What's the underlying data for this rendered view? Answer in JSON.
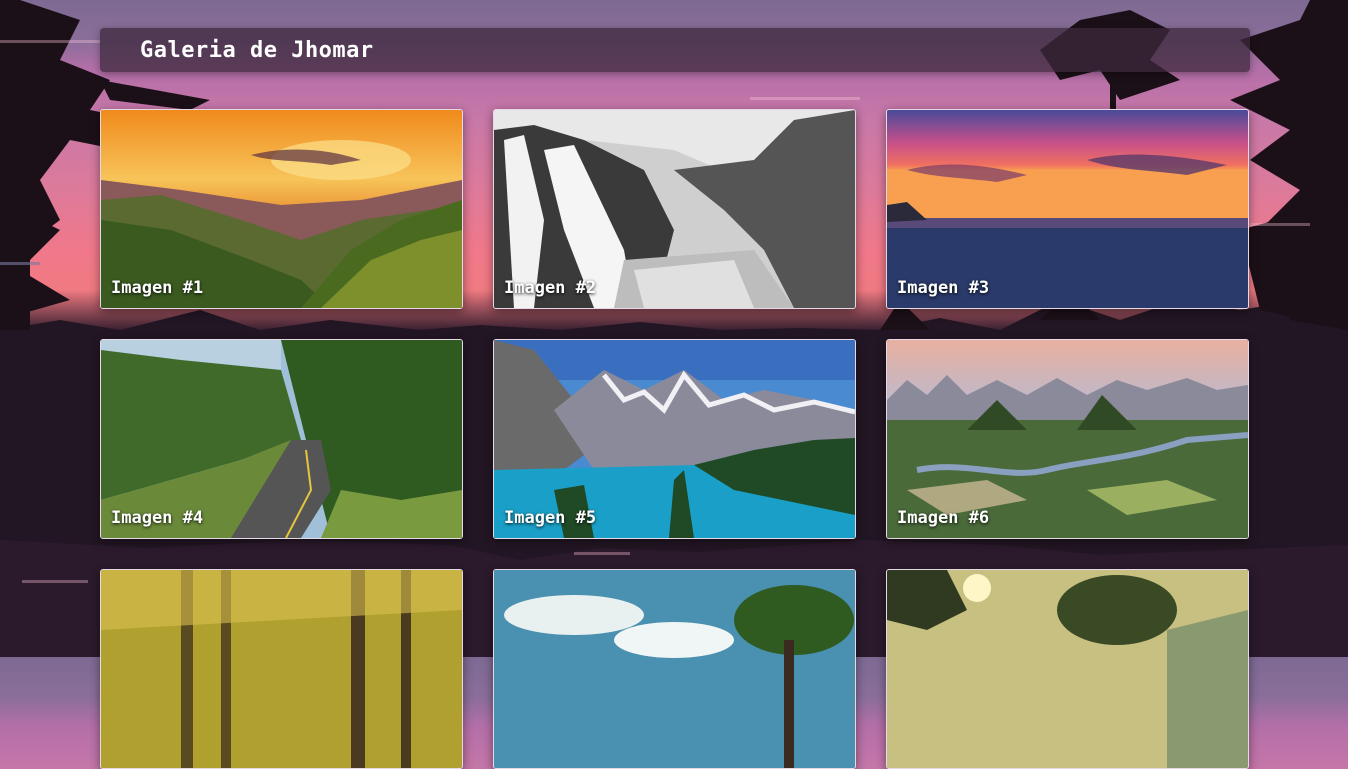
{
  "header": {
    "title": "Galeria de Jhomar"
  },
  "gallery": {
    "items": [
      {
        "caption": "Imagen #1",
        "scene": "mountain-sunset"
      },
      {
        "caption": "Imagen #2",
        "scene": "waterfall-bw"
      },
      {
        "caption": "Imagen #3",
        "scene": "ocean-sunset"
      },
      {
        "caption": "Imagen #4",
        "scene": "forest-road"
      },
      {
        "caption": "Imagen #5",
        "scene": "mountain-lake"
      },
      {
        "caption": "Imagen #6",
        "scene": "karst-valley"
      },
      {
        "caption": "",
        "scene": "golden-forest"
      },
      {
        "caption": "",
        "scene": "cloudy-tree"
      },
      {
        "caption": "",
        "scene": "sunlit-trees"
      }
    ]
  },
  "colors": {
    "header_bg": "#3c283c",
    "caption": "#ffffff",
    "card_border": "#e6d9e6"
  }
}
